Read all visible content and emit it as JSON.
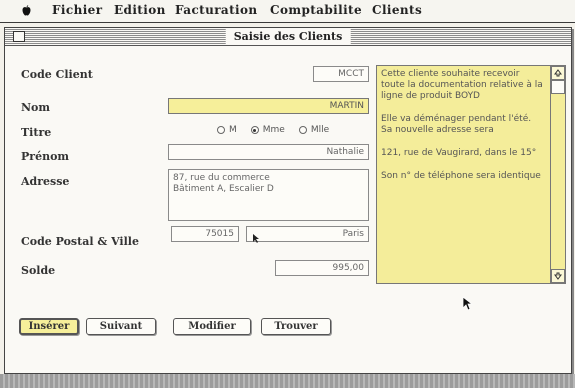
{
  "menu_bar": {
    "apple_icon": "apple-icon",
    "items": [
      "Fichier",
      "Edition",
      "Facturation",
      "Comptabilite",
      "Clients"
    ]
  },
  "window": {
    "title": "Saisie des Clients"
  },
  "form": {
    "code_client": {
      "label": "Code Client",
      "value": "MCCT"
    },
    "nom": {
      "label": "Nom",
      "value": "MARTIN"
    },
    "titre": {
      "label": "Titre",
      "options": [
        "M",
        "Mme",
        "Mlle"
      ],
      "selected": "Mme"
    },
    "prenom": {
      "label": "Prénom",
      "value": "Nathalie"
    },
    "adresse": {
      "label": "Adresse",
      "lines": [
        "87, rue du commerce",
        "Bâtiment A, Escalier D"
      ]
    },
    "code_postal_ville": {
      "label": "Code Postal & Ville",
      "code_postal": "75015",
      "ville": "Paris"
    },
    "solde": {
      "label": "Solde",
      "value": "995,00"
    }
  },
  "notes": {
    "paragraphs": [
      "Cette cliente souhaite recevoir toute la documentation relative à la ligne de produit BOYD",
      "Elle va déménager pendant l'été. Sa nouvelle adresse sera",
      "121, rue de Vaugirard, dans le 15°",
      "Son n° de téléphone sera identique"
    ]
  },
  "buttons": {
    "inserer": "Insérer",
    "suivant": "Suivant",
    "modifier": "Modifier",
    "trouver": "Trouver"
  },
  "colors": {
    "highlight_yellow": "#f6ef9a",
    "notes_yellow": "#f4ed9a"
  }
}
